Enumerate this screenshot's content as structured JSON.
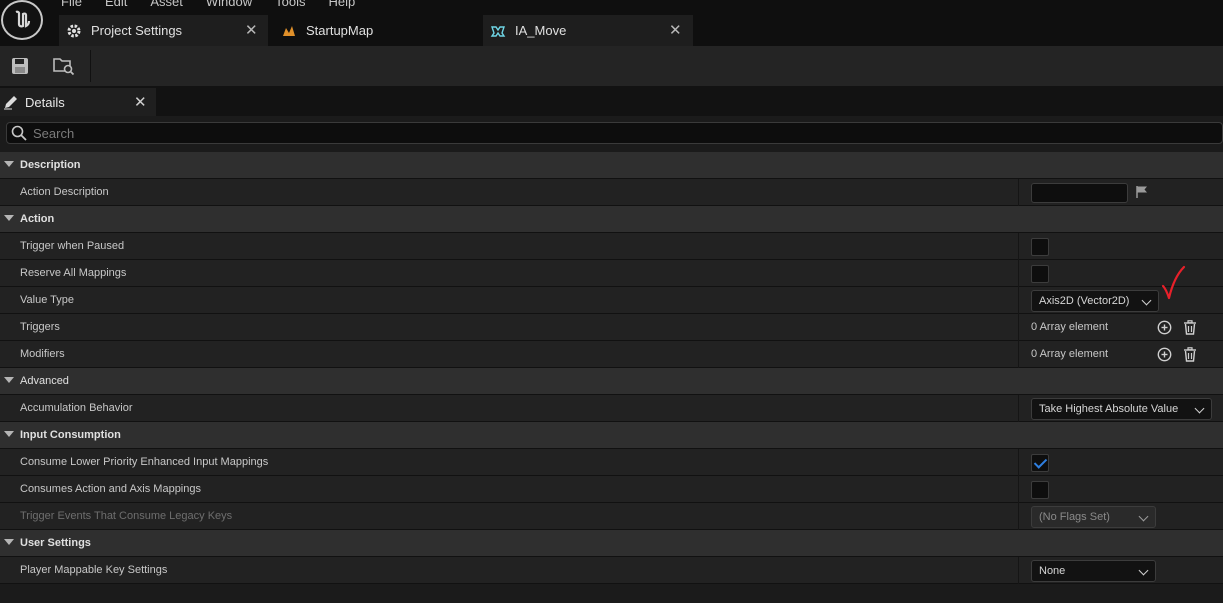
{
  "menu": [
    "File",
    "Edit",
    "Asset",
    "Window",
    "Tools",
    "Help"
  ],
  "tabs": [
    {
      "label": "Project Settings",
      "icon": "gear-icon"
    },
    {
      "label": "StartupMap",
      "icon": "level-icon"
    },
    {
      "label": "IA_Move",
      "icon": "input-action-icon"
    }
  ],
  "details": {
    "tab_label": "Details",
    "search_placeholder": "Search"
  },
  "categories": {
    "description": "Description",
    "action": "Action",
    "advanced": "Advanced",
    "input_consumption": "Input Consumption",
    "user_settings": "User Settings"
  },
  "props": {
    "action_description": "Action Description",
    "trigger_when_paused": "Trigger when Paused",
    "reserve_all_mappings": "Reserve All Mappings",
    "value_type": "Value Type",
    "value_type_value": "Axis2D (Vector2D)",
    "triggers": "Triggers",
    "triggers_value": "0 Array element",
    "modifiers": "Modifiers",
    "modifiers_value": "0 Array element",
    "accumulation_behavior": "Accumulation Behavior",
    "accumulation_behavior_value": "Take Highest Absolute Value",
    "consume_lower_priority": "Consume Lower Priority Enhanced Input Mappings",
    "consumes_action_axis": "Consumes Action and Axis Mappings",
    "trigger_events_legacy": "Trigger Events That Consume Legacy Keys",
    "trigger_events_legacy_value": "(No Flags Set)",
    "player_mappable": "Player Mappable Key Settings",
    "player_mappable_value": "None"
  },
  "state": {
    "trigger_when_paused": false,
    "reserve_all_mappings": false,
    "consume_lower_priority": true,
    "consumes_action_axis": false
  },
  "colors": {
    "accent_check": "#2f7fe0",
    "annotation": "#e8202a"
  }
}
